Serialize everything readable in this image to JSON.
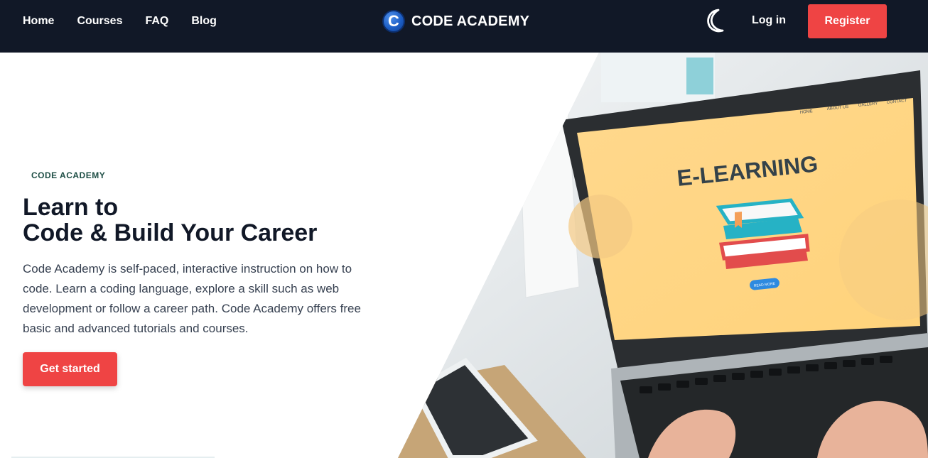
{
  "nav": {
    "links": [
      "Home",
      "Courses",
      "FAQ",
      "Blog"
    ],
    "brand_logo_letter": "C",
    "brand_name": "CODE ACADEMY",
    "theme_icon": "moon-icon",
    "login": "Log in",
    "register": "Register"
  },
  "hero": {
    "eyebrow": "CODE ACADEMY",
    "title_line_1": "Learn to",
    "title_line_2": "Code & Build Your Career",
    "description": "Code Academy is self-paced, interactive instruction on how to code. Learn a coding language, explore a skill such as web development or follow a career path. Code Academy offers free basic and advanced tutorials and courses.",
    "cta": "Get started"
  },
  "hero_image": {
    "screen_text": "E-LEARNING",
    "screen_nav": [
      "HOME",
      "ABOUT US",
      "GALLERY",
      "CONTACT"
    ],
    "screen_button": "READ MORE"
  },
  "colors": {
    "nav_background": "#111827",
    "accent": "#ef4444",
    "text_primary": "#111827"
  }
}
